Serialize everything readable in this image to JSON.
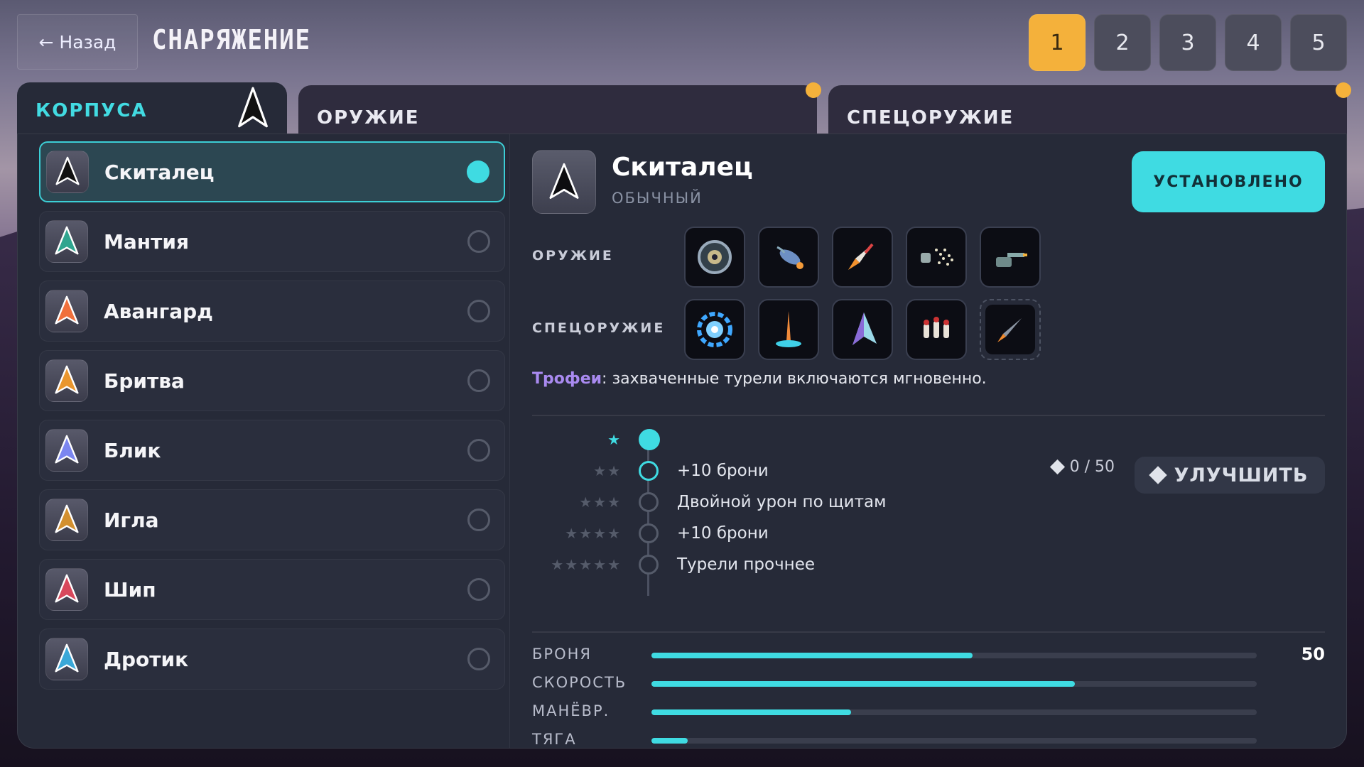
{
  "header": {
    "back_label": "← Назад",
    "title": "СНАРЯЖЕНИЕ"
  },
  "pages": [
    "1",
    "2",
    "3",
    "4",
    "5"
  ],
  "tabs": {
    "hulls": "КОРПУСА",
    "weapons": "ОРУЖИЕ",
    "special": "СПЕЦОРУЖИЕ"
  },
  "hulls": [
    {
      "name": "Скиталец",
      "icon": "black-arrow-ship-icon",
      "color": "#111111",
      "selected": true
    },
    {
      "name": "Мантия",
      "icon": "teal-ship-icon",
      "color": "#2fa58f",
      "selected": false
    },
    {
      "name": "Авангард",
      "icon": "orange-ship-icon",
      "color": "#f0703c",
      "selected": false
    },
    {
      "name": "Бритва",
      "icon": "amber-ship-icon",
      "color": "#e9962e",
      "selected": false
    },
    {
      "name": "Блик",
      "icon": "blue-ship-icon",
      "color": "#7b86f0",
      "selected": false
    },
    {
      "name": "Игла",
      "icon": "gold-ship-icon",
      "color": "#d3902f",
      "selected": false
    },
    {
      "name": "Шип",
      "icon": "red-ship-icon",
      "color": "#d8485c",
      "selected": false
    },
    {
      "name": "Дротик",
      "icon": "aqua-ship-icon",
      "color": "#3aa8d8",
      "selected": false
    }
  ],
  "detail": {
    "name": "Скиталец",
    "rarity": "ОБЫЧНЫЙ",
    "installed_label": "УСТАНОВЛЕНО",
    "weapons_label": "ОРУЖИЕ",
    "special_label": "СПЕЦОРУЖИЕ",
    "weapons": [
      "disc-launcher-icon",
      "homing-missile-icon",
      "rocket-icon",
      "scatter-gun-icon",
      "turret-cannon-icon"
    ],
    "special": [
      "shield-ring-icon",
      "orbital-strike-icon",
      "decoy-ship-icon",
      "missile-salvo-icon",
      "drone-rocket-icon"
    ],
    "note_key": "Трофеи",
    "note_text": ": захваченные турели включаются мгновенно."
  },
  "upgrades": [
    {
      "stars": "★",
      "text": ""
    },
    {
      "stars": "★★",
      "text": "+10 брони"
    },
    {
      "stars": "★★★",
      "text": "Двойной урон по щитам"
    },
    {
      "stars": "★★★★",
      "text": "+10 брони"
    },
    {
      "stars": "★★★★★",
      "text": "Турели прочнее"
    }
  ],
  "upgrade_cost": "0 / 50",
  "upgrade_label": "УЛУЧШИТЬ",
  "stats": [
    {
      "label": "БРОНЯ",
      "value": "50",
      "fill": 0.53
    },
    {
      "label": "СКОРОСТЬ",
      "value": "",
      "fill": 0.7
    },
    {
      "label": "МАНЁВР.",
      "value": "",
      "fill": 0.33
    },
    {
      "label": "ТЯГА",
      "value": "",
      "fill": 0.06
    }
  ],
  "colors": {
    "accent": "#3fdbe2",
    "page_active": "#f4b13b",
    "note_key": "#a98af0"
  }
}
